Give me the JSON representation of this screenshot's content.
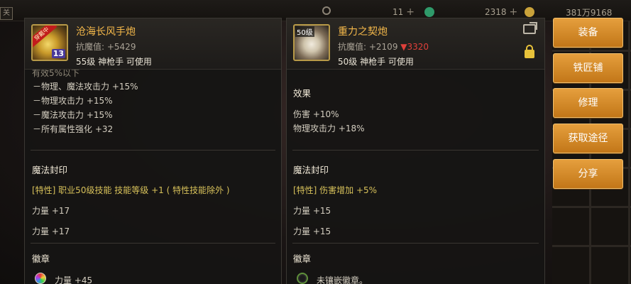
{
  "topbar": {
    "tab_label": "关",
    "resource_1": "11",
    "resource_2": "2318",
    "resource_3": "381万9168"
  },
  "left_item": {
    "name": "沧海长风手炮",
    "resist": "抗魔值: +5429",
    "meta": "55级 神枪手 可使用",
    "icon_ribbon": "穿戴中",
    "icon_plus": "13",
    "cut_line": "有效5%以下",
    "stats": [
      "－物理、魔法攻击力 +15%",
      "－物理攻击力 +15%",
      "－魔法攻击力 +15%",
      "－所有属性强化 +32"
    ],
    "seal_title": "魔法封印",
    "seal_feature": "[特性] 职业50级技能 技能等级 +1 ( 特性技能除外 )",
    "seal_stat_1": "力量 +17",
    "seal_stat_2": "力量 +17",
    "emblem_title": "徽章",
    "emblem_stat": "力量 +45"
  },
  "right_item": {
    "name": "重力之契炮",
    "resist_prefix": "抗魔值: +2109",
    "resist_down": "▼3320",
    "meta": "50级 神枪手 可使用",
    "icon_lvl": "50级",
    "effect_title": "效果",
    "effect_1": "伤害 +10%",
    "effect_2": "物理攻击力 +18%",
    "seal_title": "魔法封印",
    "seal_feature": "[特性] 伤害增加 +5%",
    "seal_stat_1": "力量 +15",
    "seal_stat_2": "力量 +15",
    "emblem_title": "徽章",
    "emblem_stat": "未镶嵌徽章。"
  },
  "menu": [
    "装备",
    "铁匠铺",
    "修理",
    "获取途径",
    "分享"
  ],
  "colors": {
    "item_name": "#f4b84a",
    "feature_text": "#d7c15a",
    "resist_down": "#e0403a",
    "button": "#d88a2a"
  }
}
